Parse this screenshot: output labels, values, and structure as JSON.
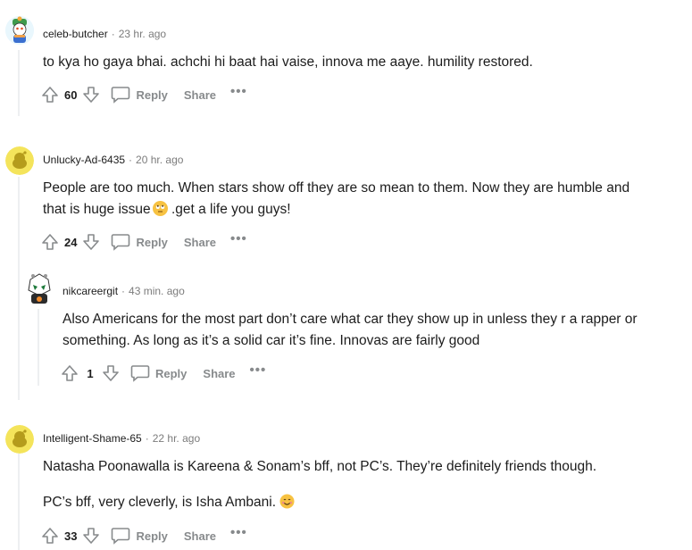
{
  "comments": [
    {
      "user": "celeb-butcher",
      "time": "23 hr. ago",
      "body": [
        "to kya ho gaya bhai. achchi hi baat hai vaise, innova me aaye. humility restored."
      ],
      "score": "60",
      "reply": "Reply",
      "share": "Share",
      "more": "•••"
    },
    {
      "user": "Unlucky-Ad-6435",
      "time": "20 hr. ago",
      "body_line1": "People are too much. When stars show off they are so mean to them. Now they are humble and",
      "body_line2a": "that is huge issue",
      "body_line2b": " .get a life you guys!",
      "emoji": "rolling-eyes-emoji",
      "score": "24",
      "reply": "Reply",
      "share": "Share",
      "more": "•••"
    },
    {
      "user": "nikcareergit",
      "time": "43 min. ago",
      "body": [
        "Also Americans for the most part don’t care what car they show up in unless they r a rapper or something. As long as it’s a solid car it’s fine. Innovas are fairly good"
      ],
      "score": "1",
      "reply": "Reply",
      "share": "Share",
      "more": "•••"
    },
    {
      "user": "Intelligent-Shame-65",
      "time": "22 hr. ago",
      "body_p1": "Natasha Poonawalla is Kareena & Sonam’s bff, not PC’s. They’re definitely friends though.",
      "body_p2": "PC’s bff, very cleverly, is Isha Ambani.",
      "emoji": "smiling-emoji",
      "score": "33",
      "reply": "Reply",
      "share": "Share",
      "more": "•••"
    }
  ],
  "separator": "·",
  "colors": {
    "meta": "#7c7c7c",
    "action": "#878a8c",
    "thread": "#edeff1",
    "text": "#1c1c1c"
  }
}
